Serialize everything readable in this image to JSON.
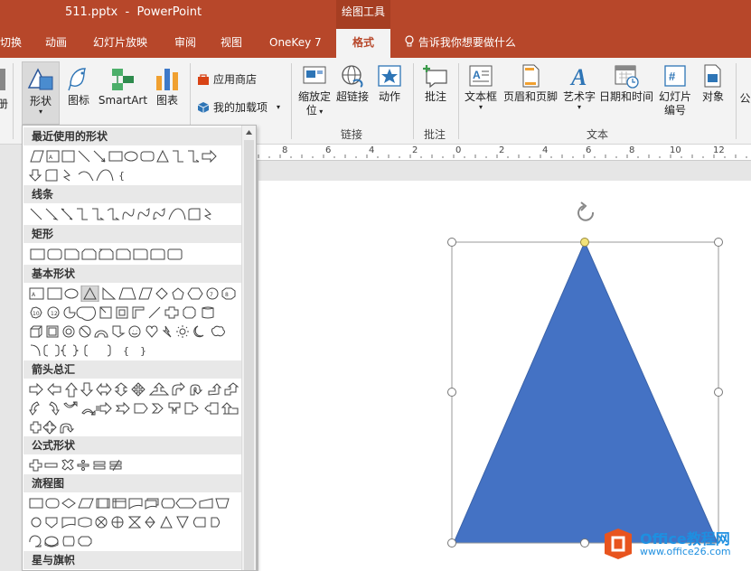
{
  "titlebar": {
    "doc_title": "511.pptx  -  PowerPoint",
    "context_group": "绘图工具"
  },
  "tabs": [
    {
      "label": "切换"
    },
    {
      "label": "动画"
    },
    {
      "label": "幻灯片放映"
    },
    {
      "label": "审阅"
    },
    {
      "label": "视图"
    },
    {
      "label": "OneKey 7"
    },
    {
      "label": "格式"
    }
  ],
  "tell_me": "告诉我你想要做什么",
  "ribbon": {
    "partial_left": "册",
    "shapes": "形状",
    "icons": "图标",
    "smartart": "SmartArt",
    "chart": "图表",
    "store": "应用商店",
    "my_addins": "我的加载项",
    "zoom_line1": "缩放定",
    "zoom_line2": "位",
    "hyperlink": "超链接",
    "action": "动作",
    "group_links": "链接",
    "comment": "批注",
    "group_comments": "批注",
    "textbox": "文本框",
    "header_footer": "页眉和页脚",
    "wordart": "艺术字",
    "datetime": "日期和时间",
    "slide_num_line1": "幻灯片",
    "slide_num_line2": "编号",
    "object": "对象",
    "group_text": "文本",
    "partial_right": "公"
  },
  "shapes_panel": {
    "sections": [
      {
        "title": "最近使用的形状"
      },
      {
        "title": "线条"
      },
      {
        "title": "矩形"
      },
      {
        "title": "基本形状"
      },
      {
        "title": "箭头总汇"
      },
      {
        "title": "公式形状"
      },
      {
        "title": "流程图"
      },
      {
        "title": "星与旗帜"
      }
    ]
  },
  "ruler_ticks": [
    "8",
    "6",
    "4",
    "2",
    "0",
    "2",
    "4",
    "6",
    "8",
    "10",
    "12"
  ],
  "colors": {
    "accent": "#b7472a",
    "triangle_fill": "#4472c4",
    "handle_yellow": "#f2e27a"
  },
  "watermark": {
    "main": "Office教程网",
    "sub": "www.office26.com"
  }
}
